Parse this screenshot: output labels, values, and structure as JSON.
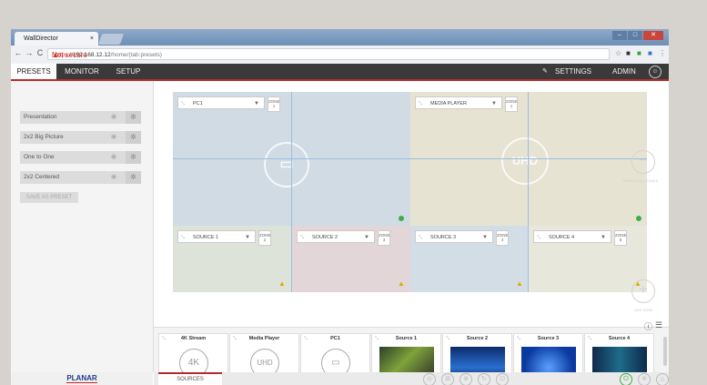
{
  "browser": {
    "tab_title": "WallDirector",
    "tab_close": "×",
    "url_warning": "Not secure",
    "url_https": "https://",
    "url_host": "192.168.12.12",
    "url_path": "/home/(tab:presets)",
    "back": "←",
    "forward": "→",
    "reload": "C"
  },
  "nav": {
    "tabs": [
      "PRESETS",
      "MONITOR",
      "SETUP"
    ],
    "active_tab": "PRESETS",
    "settings": "SETTINGS",
    "admin": "ADMIN"
  },
  "sidebar": {
    "presets": [
      "Presentation",
      "2x2 Big Picture",
      "One to One",
      "2x2 Centered"
    ],
    "save_button": "SAVE AS PRESET"
  },
  "canvas": {
    "zones": [
      {
        "label": "PC1",
        "zone_word": "ZONE",
        "zone_num": "1",
        "color": "#d0dbe4"
      },
      {
        "label": "MEDIA PLAYER",
        "zone_word": "ZONE",
        "zone_num": "1",
        "color": "#e6e3d3"
      },
      {
        "label": "SOURCE 1",
        "zone_word": "ZONE",
        "zone_num": "2",
        "color": "#dde3d8"
      },
      {
        "label": "SOURCE 2",
        "zone_word": "ZONE",
        "zone_num": "3",
        "color": "#e3d6d8"
      },
      {
        "label": "SOURCE 3",
        "zone_word": "ZONE",
        "zone_num": "4",
        "color": "#d3dde6"
      },
      {
        "label": "SOURCE 4",
        "zone_word": "ZONE",
        "zone_num": "5",
        "color": "#e8e7dc"
      }
    ],
    "uhd_label": "UHD",
    "side_minus_text": "DELETE ALL ZONES",
    "side_plus_text": "ADD ZONE"
  },
  "sources": {
    "items": [
      "4K Stream",
      "Media Player",
      "PC1",
      "Source 1",
      "Source 2",
      "Source 3",
      "Source 4"
    ],
    "icon_4k": "4K",
    "icon_uhd": "UHD"
  },
  "footer": {
    "sources_tab": "SOURCES",
    "logo": "PLANAR"
  },
  "colors": {
    "accent": "#b32c2c",
    "header": "#3a3a3a",
    "ok": "#3fae49",
    "warning": "#e0a800"
  }
}
